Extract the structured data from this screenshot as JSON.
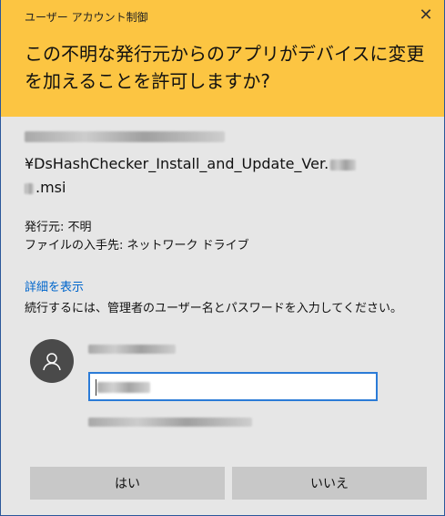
{
  "header": {
    "window_title": "ユーザー アカウント制御",
    "question": "この不明な発行元からのアプリがデバイスに変更を加えることを許可しますか?"
  },
  "program": {
    "path_line2": "¥DsHashChecker_Install_and_Update_Ver.",
    "path_line3": ".msi"
  },
  "publisher": {
    "label": "発行元: 不明",
    "origin": "ファイルの入手先: ネットワーク ドライブ"
  },
  "details_link": "詳細を表示",
  "instruction": "続行するには、管理者のユーザー名とパスワードを入力してください。",
  "buttons": {
    "yes": "はい",
    "no": "いいえ"
  },
  "colors": {
    "header": "#fcc542",
    "body": "#e6e6e6",
    "accent": "#2b7bd7",
    "link": "#0066cc",
    "button": "#c8c8c8"
  },
  "icons": {
    "close": "close-icon",
    "avatar": "user-icon"
  }
}
